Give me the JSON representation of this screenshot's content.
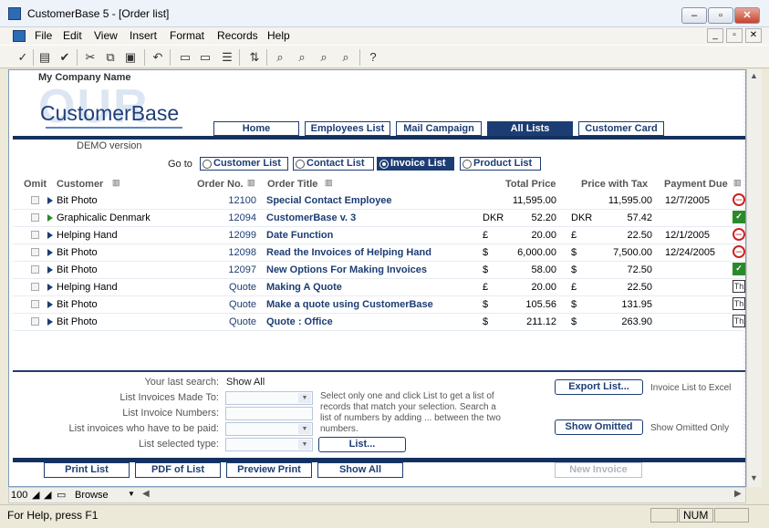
{
  "window": {
    "title": "CustomerBase 5 - [Order list]"
  },
  "menu": [
    "File",
    "Edit",
    "View",
    "Insert",
    "Format",
    "Records",
    "Help"
  ],
  "header": {
    "company": "My Company Name",
    "logo_bg": "OUR",
    "logo": "CustomerBase",
    "demo": "DEMO version"
  },
  "nav": [
    "Home",
    "Employees List",
    "Mail Campaign",
    "All Lists",
    "Customer Card"
  ],
  "goto": {
    "label": "Go to",
    "options": [
      "Customer List",
      "Contact List",
      "Invoice List",
      "Product List"
    ],
    "selected": "Invoice List"
  },
  "columns": {
    "omit": "Omit",
    "customer": "Customer",
    "order_no": "Order No.",
    "order_title": "Order Title",
    "total_price": "Total Price",
    "price_tax": "Price with Tax",
    "payment_due": "Payment Due"
  },
  "rows": [
    {
      "customer": "Bit Photo",
      "order_no": "12100",
      "title": "Special Contact Employee",
      "cur1": "",
      "total": "11,595.00",
      "cur2": "",
      "tax": "11,595.00",
      "due": "12/7/2005",
      "status": "no",
      "arrow": "blue"
    },
    {
      "customer": "Graphicalic Denmark",
      "order_no": "12094",
      "title": "CustomerBase v. 3",
      "cur1": "DKR",
      "total": "52.20",
      "cur2": "DKR",
      "tax": "57.42",
      "due": "",
      "status": "ok",
      "arrow": "green"
    },
    {
      "customer": "Helping Hand",
      "order_no": "12099",
      "title": "Date Function",
      "cur1": "£",
      "total": "20.00",
      "cur2": "£",
      "tax": "22.50",
      "due": "12/1/2005",
      "status": "no",
      "arrow": "blue"
    },
    {
      "customer": "Bit Photo",
      "order_no": "12098",
      "title": "Read the Invoices of Helping Hand",
      "cur1": "$",
      "total": "6,000.00",
      "cur2": "$",
      "tax": "7,500.00",
      "due": "12/24/2005",
      "status": "no",
      "arrow": "blue"
    },
    {
      "customer": "Bit Photo",
      "order_no": "12097",
      "title": "New Options For Making Invoices",
      "cur1": "$",
      "total": "58.00",
      "cur2": "$",
      "tax": "72.50",
      "due": "",
      "status": "ok",
      "arrow": "blue"
    },
    {
      "customer": "Helping Hand",
      "order_no": "Quote",
      "title": "Making A Quote",
      "cur1": "£",
      "total": "20.00",
      "cur2": "£",
      "tax": "22.50",
      "due": "",
      "status": "th",
      "arrow": "blue"
    },
    {
      "customer": "Bit Photo",
      "order_no": "Quote",
      "title": "Make a quote using CustomerBase",
      "cur1": "$",
      "total": "105.56",
      "cur2": "$",
      "tax": "131.95",
      "due": "",
      "status": "th",
      "arrow": "blue"
    },
    {
      "customer": "Bit Photo",
      "order_no": "Quote",
      "title": "Quote : Office",
      "cur1": "$",
      "total": "211.12",
      "cur2": "$",
      "tax": "263.90",
      "due": "",
      "status": "th",
      "arrow": "blue"
    }
  ],
  "status_text": {
    "th": "Th"
  },
  "search": {
    "last_search_label": "Your last search:",
    "last_search_value": "Show All",
    "made_to_label": "List Invoices Made To:",
    "numbers_label": "List Invoice Numbers:",
    "to_be_paid_label": "List invoices who have to be paid:",
    "selected_type_label": "List selected type:",
    "help": "Select only one and click List to get a list of records that match your selection. Search a list of numbers by adding ... between the two numbers.",
    "list_button": "List..."
  },
  "export": {
    "button": "Export List...",
    "note": "Invoice List to Excel"
  },
  "omitted": {
    "button": "Show Omitted",
    "note": "Show Omitted Only"
  },
  "bottom_buttons": [
    "Print List",
    "PDF of List",
    "Preview Print",
    "Show All",
    "New Invoice"
  ],
  "hscroll": {
    "zoom": "100",
    "mode": "Browse"
  },
  "statusbar": {
    "text": "For Help, press F1",
    "num": "NUM"
  }
}
